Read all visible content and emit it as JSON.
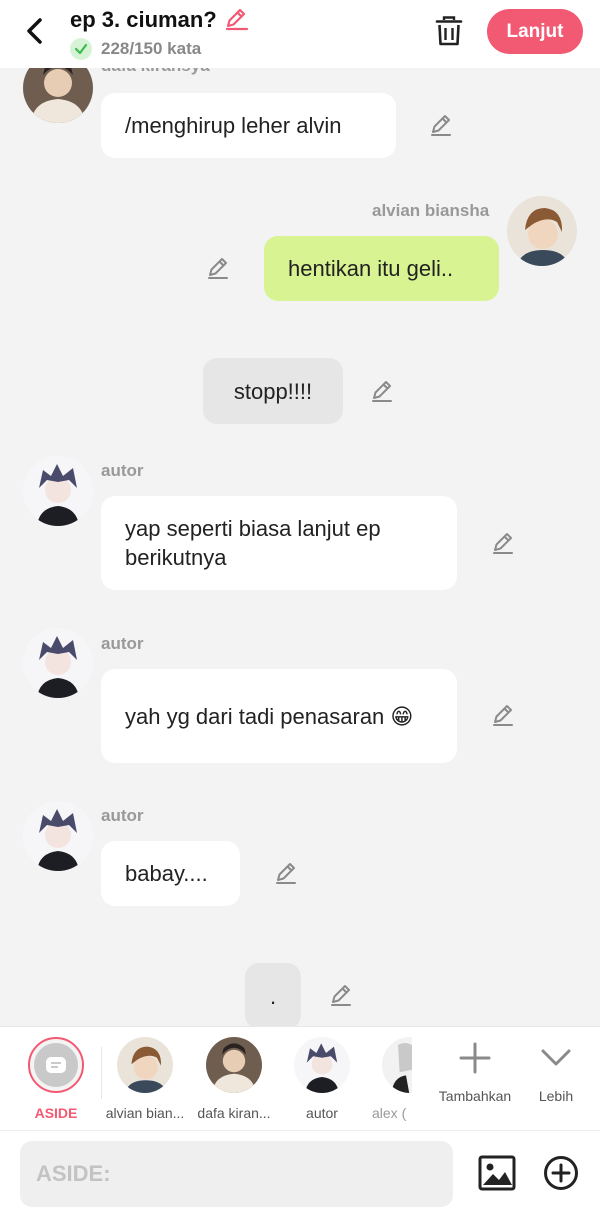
{
  "header": {
    "title": "ep 3. ciuman?",
    "word_count": "228/150 kata",
    "next_label": "Lanjut"
  },
  "messages": [
    {
      "speaker": "dafa kiransya",
      "text": "/menghirup leher alvin"
    },
    {
      "speaker": "alvian biansha",
      "text": "hentikan itu geli.."
    },
    {
      "speaker": "",
      "text": "stopp!!!!"
    },
    {
      "speaker": "autor",
      "text": "yap seperti biasa lanjut ep berikutnya"
    },
    {
      "speaker": "autor",
      "text": "yah yg dari tadi penasaran 😁"
    },
    {
      "speaker": "autor",
      "text": "babay...."
    },
    {
      "speaker": "",
      "text": "."
    }
  ],
  "characters": [
    {
      "label": "ASIDE"
    },
    {
      "label": "alvian bian..."
    },
    {
      "label": "dafa kiran..."
    },
    {
      "label": "autor"
    },
    {
      "label": "alex ("
    }
  ],
  "actions": {
    "add_label": "Tambahkan",
    "more_label": "Lebih"
  },
  "input": {
    "placeholder": "ASIDE:"
  },
  "colors": {
    "accent": "#f25a73",
    "green_bubble": "#d7f392",
    "background": "#f3f3f3"
  },
  "icons": [
    "back-arrow-icon",
    "pencil-icon",
    "check-icon",
    "trash-icon",
    "plus-icon",
    "chevron-down-icon",
    "image-icon",
    "add-circle-icon"
  ]
}
